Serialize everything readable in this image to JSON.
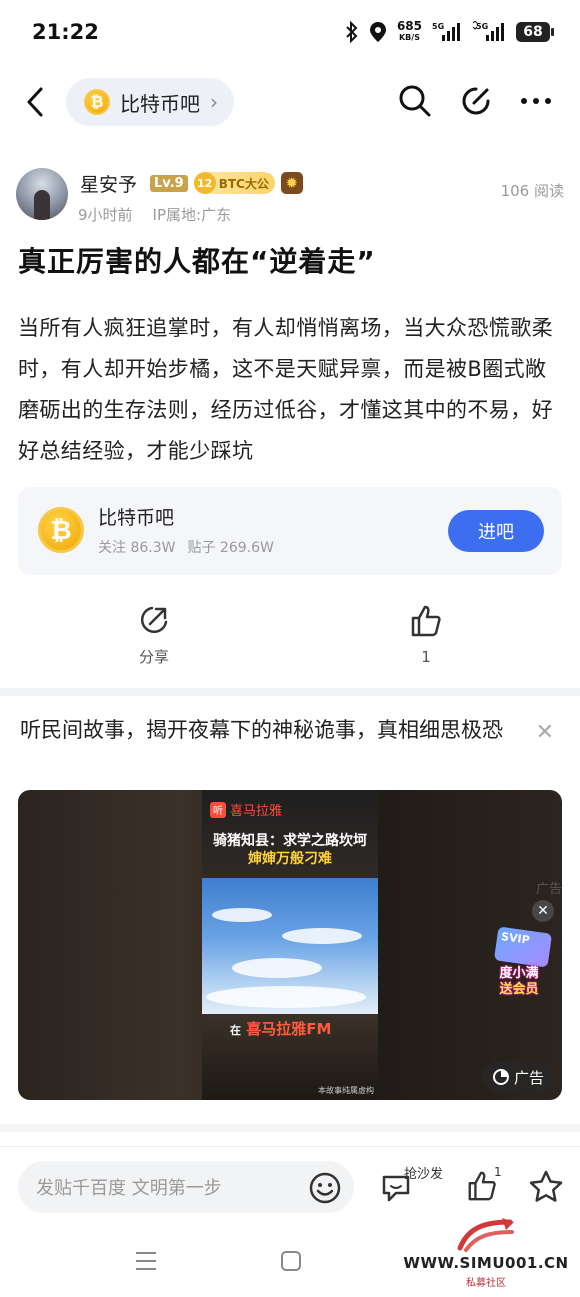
{
  "status_bar": {
    "time": "21:22",
    "net_speed": "685",
    "net_unit": "KB/S",
    "sim1": "5G",
    "sim2": "5G",
    "battery": "68"
  },
  "nav": {
    "forum_name": "比特币吧",
    "icons": [
      "back-arrow-icon",
      "bitcoin-icon",
      "search-icon",
      "edit-icon",
      "more-icon"
    ]
  },
  "post": {
    "author": "星安予",
    "level": "Lv.9",
    "badge_num": "12",
    "badge_text": "BTC大公",
    "time_ago": "9小时前",
    "ip_location": "IP属地:广东",
    "views": "106 阅读",
    "title": "真正厉害的人都在“逆着走”",
    "body": "当所有人疯狂追掌时，有人却悄悄离场，当大众恐慌歌柔时，有人却开始步橘，这不是天赋异禀，而是被B圈式敞磨砺出的生存法则，经历过低谷，才懂这其中的不易，好好总结经验，才能少踩坑"
  },
  "forum_card": {
    "name": "比特币吧",
    "followers": "关注 86.3W",
    "posts": "贴子 269.6W",
    "enter_label": "进吧"
  },
  "actions": {
    "share_label": "分享",
    "like_count": "1"
  },
  "ad": {
    "title": "听民间故事，揭开夜幕下的神秘诡事，真相细思极恐",
    "brand": "喜马拉雅",
    "brand_logo": "听",
    "headline1": "骑猪知县：求学之路坎坷",
    "headline2": "婶婶万般刁难",
    "fm_text": "喜马拉雅FM",
    "fm_prefix": "在",
    "disclaimer": "本故事纯属虚构",
    "side_tag": "广告",
    "svip_badge": "SVIP",
    "svip_line1": "度小满",
    "svip_line2": "送会员",
    "ad_label": "广告"
  },
  "bottom_bar": {
    "input_placeholder": "发贴千百度 文明第一步",
    "sofa_label": "抢沙发",
    "like_count": "1"
  },
  "watermark": {
    "url": "WWW.SIMU001.CN",
    "subtitle": "私募社区"
  }
}
